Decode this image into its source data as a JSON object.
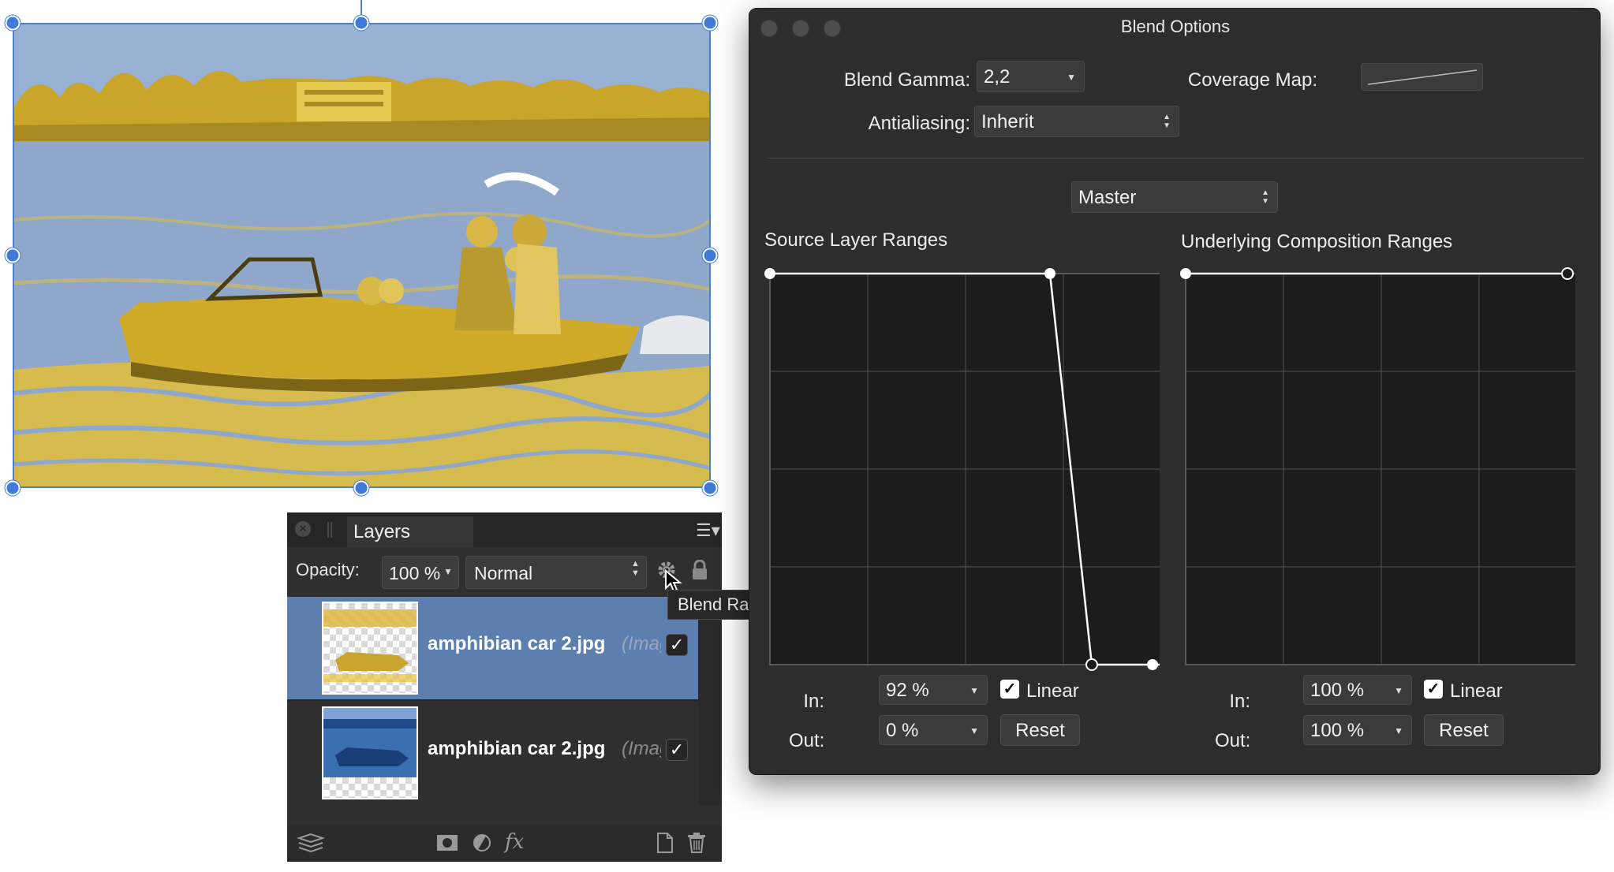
{
  "layers_panel": {
    "tab_label": "Layers",
    "opacity_label": "Opacity:",
    "opacity_value": "100 %",
    "blend_mode": "Normal",
    "layers": [
      {
        "name": "amphibian car 2.jpg",
        "kind": "(Image)",
        "visible": "✓"
      },
      {
        "name": "amphibian car 2.jpg",
        "kind": "(Image)",
        "visible": "✓"
      }
    ]
  },
  "tooltip": "Blend Ranges",
  "blend_options": {
    "title": "Blend Options",
    "blend_gamma_label": "Blend Gamma:",
    "blend_gamma_value": "2,2",
    "coverage_map_label": "Coverage Map:",
    "antialiasing_label": "Antialiasing:",
    "antialiasing_value": "Inherit",
    "channel_value": "Master",
    "source": {
      "heading": "Source Layer Ranges",
      "in_label": "In:",
      "in_value": "92 %",
      "out_label": "Out:",
      "out_value": "0 %",
      "linear_label": "Linear",
      "linear_checked": "✓",
      "reset_label": "Reset"
    },
    "underlying": {
      "heading": "Underlying Composition Ranges",
      "in_label": "In:",
      "in_value": "100 %",
      "out_label": "Out:",
      "out_value": "100 %",
      "linear_label": "Linear",
      "linear_checked": "✓",
      "reset_label": "Reset"
    }
  },
  "colors": {
    "selection": "#4a80d8",
    "selected_row": "#5d7fb0",
    "image_blue": "#8fa8cc",
    "image_yellow": "#e8c23a"
  }
}
